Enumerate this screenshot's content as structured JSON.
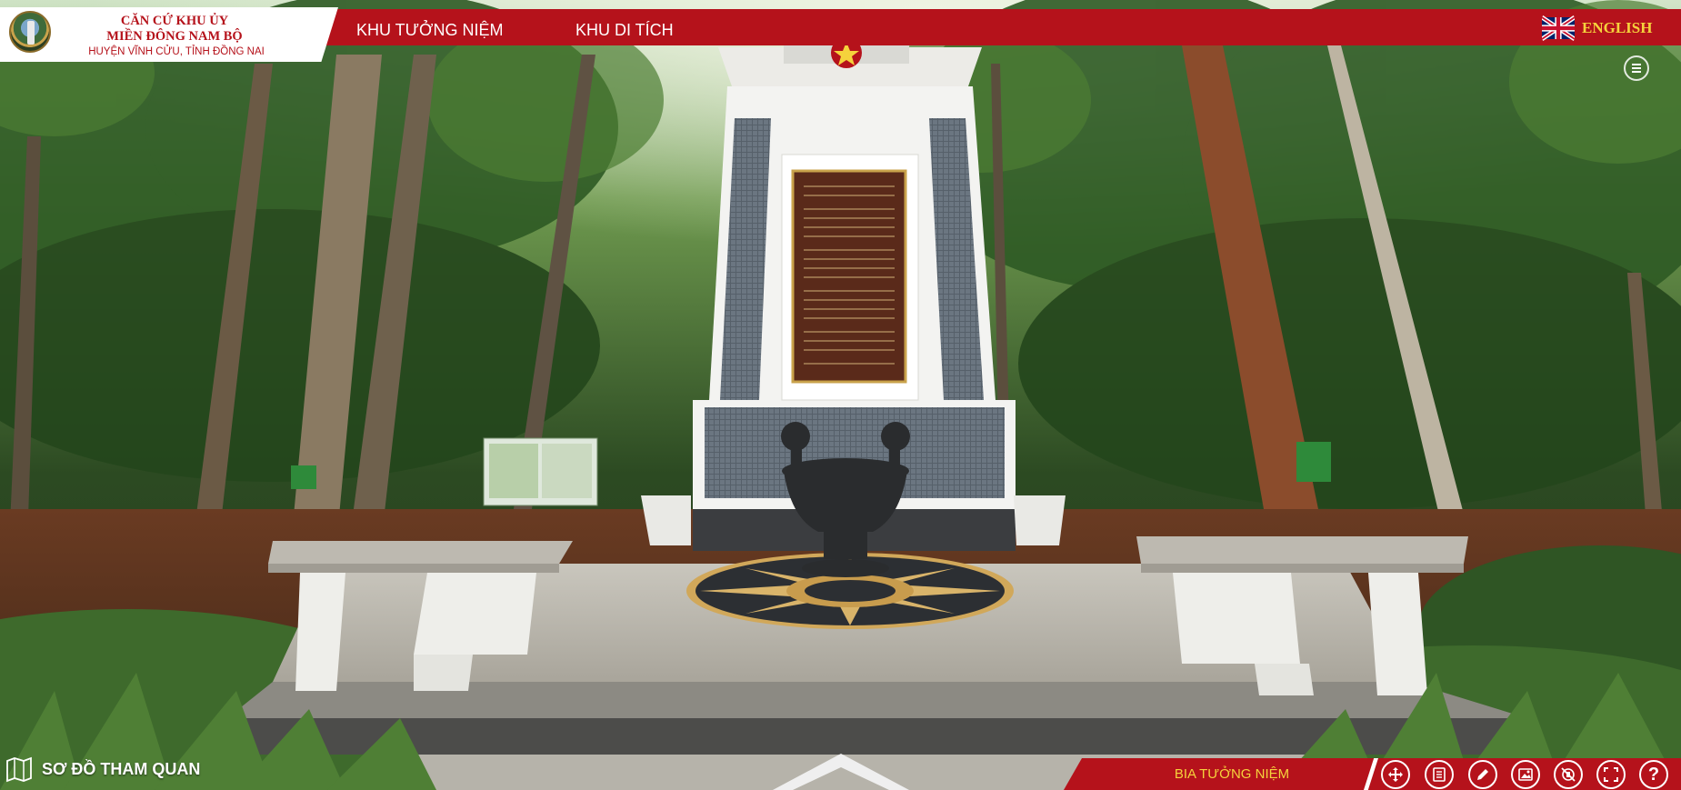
{
  "brand": {
    "line1": "CĂN CỨ KHU ỦY",
    "line2": "MIỀN ĐÔNG NAM BỘ",
    "line3": "HUYỆN VĨNH CỬU, TỈNH ĐỒNG NAI",
    "logo_icon": "monument-seal-logo"
  },
  "nav": {
    "items": [
      {
        "label": "KHU TƯỞNG NIỆM"
      },
      {
        "label": "KHU DI TÍCH"
      }
    ]
  },
  "language": {
    "label": "ENGLISH",
    "flag_icon": "uk-flag-icon"
  },
  "menu": {
    "icon": "menu-icon"
  },
  "tour_map": {
    "label": "SƠ ĐỒ THAM QUAN",
    "icon": "map-icon"
  },
  "scene": {
    "title": "BIA TƯỞNG NIỆM"
  },
  "controls": {
    "icons": [
      "move-icon",
      "info-icon",
      "pen-icon",
      "gallery-icon",
      "gyro-icon",
      "fullscreen-icon",
      "help-icon"
    ],
    "help_glyph": "?"
  },
  "colors": {
    "brand_red": "#b5121b",
    "accent_yellow": "#f5d23c",
    "white": "#ffffff"
  }
}
